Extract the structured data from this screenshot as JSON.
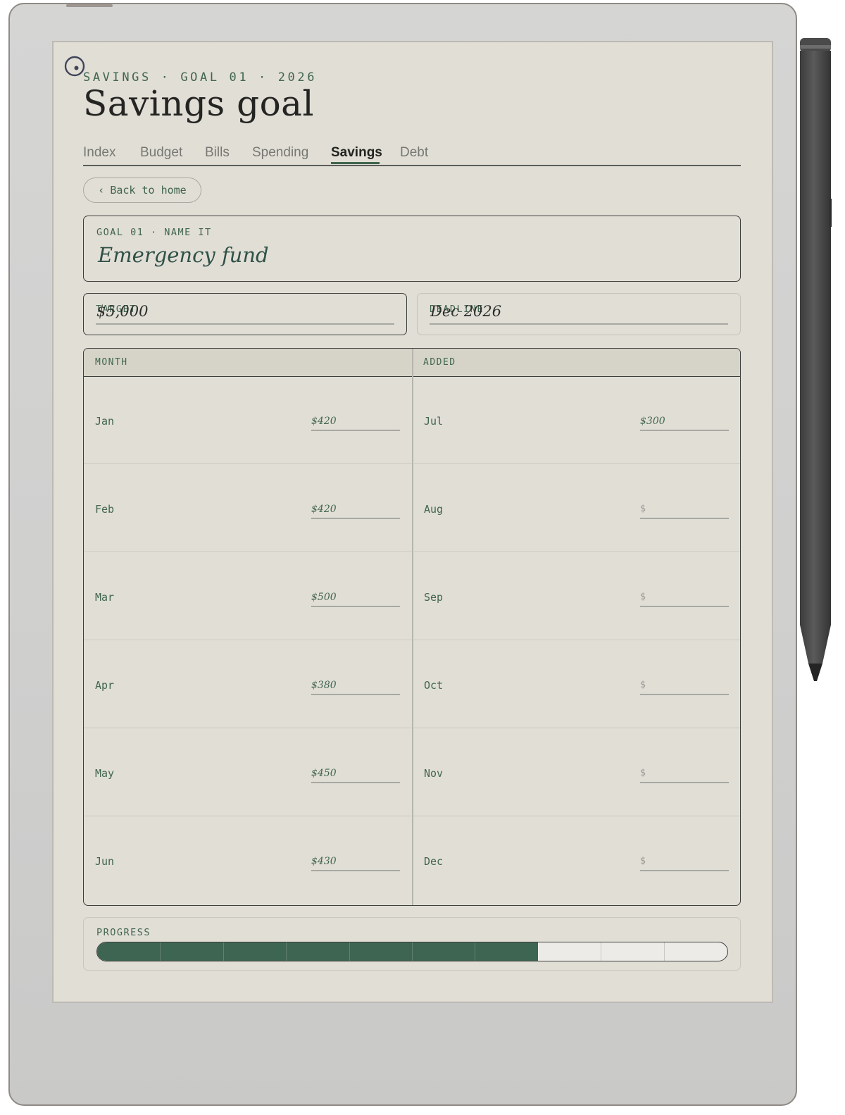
{
  "header": {
    "kicker": "SAVINGS · GOAL 01 · 2026",
    "title": "Savings goal"
  },
  "tabs": [
    {
      "label": "Index"
    },
    {
      "label": "Budget"
    },
    {
      "label": "Bills"
    },
    {
      "label": "Spending"
    },
    {
      "label": "Savings",
      "active": true
    },
    {
      "label": "Debt"
    }
  ],
  "back_button": {
    "icon": "chevron-left-icon",
    "glyph": "‹",
    "label": "Back to home"
  },
  "goal": {
    "label": "GOAL 01 · NAME IT",
    "name": "Emergency fund"
  },
  "target": {
    "label": "TARGET",
    "value": "$5,000"
  },
  "deadline": {
    "label": "DEADLINE",
    "value": "Dec 2026"
  },
  "table": {
    "headers": [
      "MONTH",
      "ADDED"
    ],
    "left_rows": [
      {
        "month": "Jan",
        "amount": "$420"
      },
      {
        "month": "Feb",
        "amount": "$420"
      },
      {
        "month": "Mar",
        "amount": "$500"
      },
      {
        "month": "Apr",
        "amount": "$380"
      },
      {
        "month": "May",
        "amount": "$450"
      },
      {
        "month": "Jun",
        "amount": "$430"
      }
    ],
    "right_rows": [
      {
        "month": "Jul",
        "amount": "$300"
      },
      {
        "month": "Aug",
        "amount": "$"
      },
      {
        "month": "Sep",
        "amount": "$"
      },
      {
        "month": "Oct",
        "amount": "$"
      },
      {
        "month": "Nov",
        "amount": "$"
      },
      {
        "month": "Dec",
        "amount": "$"
      }
    ]
  },
  "progress": {
    "label": "PROGRESS",
    "filled_segments": 7,
    "total_segments": 10
  },
  "colors": {
    "accent": "#41664f",
    "fill": "#3e6552",
    "screen": "#e1ded6"
  },
  "icons": {
    "power": "power-circle-icon",
    "stylus": "stylus-pen-icon"
  }
}
